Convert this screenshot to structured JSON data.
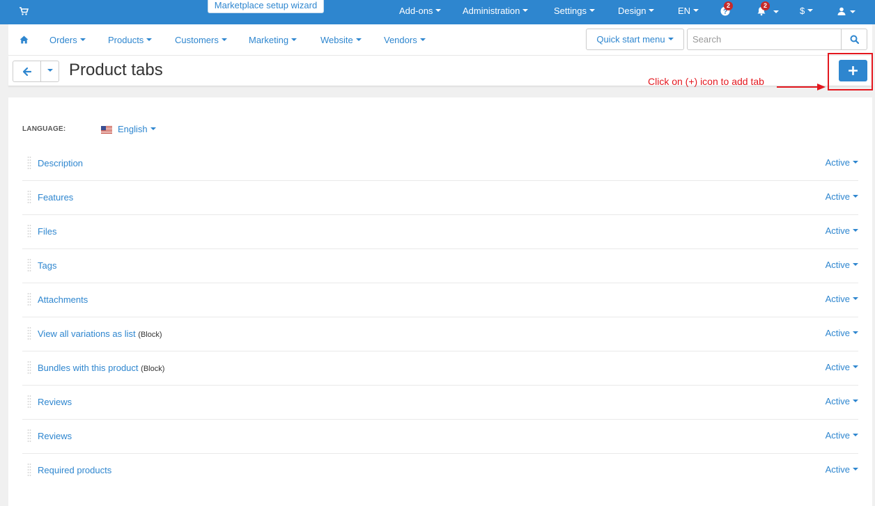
{
  "topbar": {
    "wizard_label": "Marketplace setup wizard",
    "items": [
      {
        "label": "Add-ons"
      },
      {
        "label": "Administration"
      },
      {
        "label": "Settings"
      },
      {
        "label": "Design"
      },
      {
        "label": "EN"
      }
    ],
    "help_badge": "2",
    "notifications_badge": "2",
    "currency": "$",
    "accent_color": "#2e86cf"
  },
  "nav": {
    "items": [
      {
        "label": "Orders"
      },
      {
        "label": "Products"
      },
      {
        "label": "Customers"
      },
      {
        "label": "Marketing"
      },
      {
        "label": "Website"
      },
      {
        "label": "Vendors"
      }
    ],
    "quick_start_label": "Quick start menu",
    "search_placeholder": "Search"
  },
  "page": {
    "title": "Product tabs",
    "annotation": "Click on (+) icon to add tab",
    "annotation_color": "#e3171e"
  },
  "language": {
    "label": "LANGUAGE:",
    "value": "English"
  },
  "tabs": [
    {
      "label": "Description",
      "suffix": "",
      "status": "Active"
    },
    {
      "label": "Features",
      "suffix": "",
      "status": "Active"
    },
    {
      "label": "Files",
      "suffix": "",
      "status": "Active"
    },
    {
      "label": "Tags",
      "suffix": "",
      "status": "Active"
    },
    {
      "label": "Attachments",
      "suffix": "",
      "status": "Active"
    },
    {
      "label": "View all variations as list",
      "suffix": "(Block)",
      "status": "Active"
    },
    {
      "label": "Bundles with this product",
      "suffix": "(Block)",
      "status": "Active"
    },
    {
      "label": "Reviews",
      "suffix": "",
      "status": "Active"
    },
    {
      "label": "Reviews",
      "suffix": "",
      "status": "Active"
    },
    {
      "label": "Required products",
      "suffix": "",
      "status": "Active"
    }
  ]
}
